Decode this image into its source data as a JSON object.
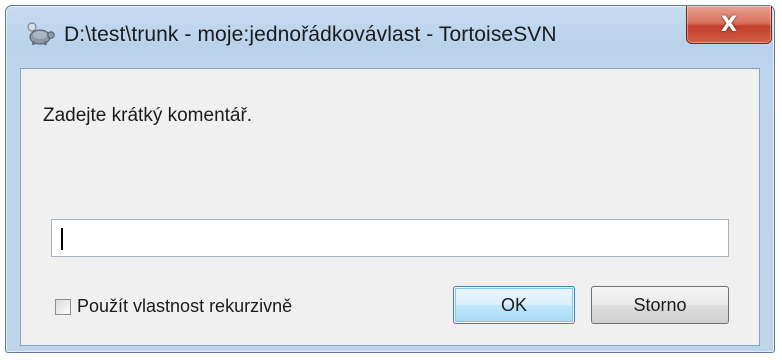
{
  "window": {
    "title": "D:\\test\\trunk - moje:jednořádkovávlast - TortoiseSVN",
    "close_symbol": "X",
    "icon": "tortoise-icon"
  },
  "dialog": {
    "prompt": "Zadejte krátký komentář.",
    "input": {
      "value": "",
      "placeholder": ""
    },
    "checkbox": {
      "label": "Použít vlastnost rekurzivně",
      "checked": false
    },
    "buttons": {
      "ok_label": "OK",
      "cancel_label": "Storno"
    }
  },
  "colors": {
    "frame": "#bfd5ec",
    "close_button": "#c2402a",
    "client_background": "#f0f0f0",
    "default_button_border": "#3c7fb1"
  }
}
